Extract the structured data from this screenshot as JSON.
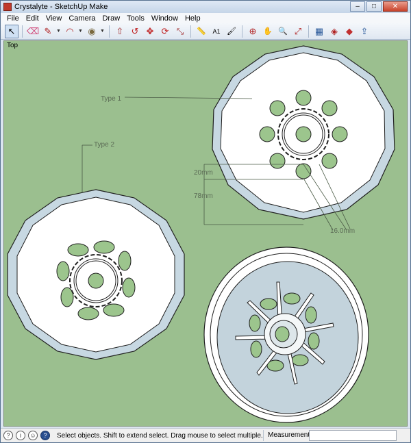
{
  "window": {
    "title": "Crystalyte - SketchUp Make",
    "controls": {
      "minimize": "–",
      "maximize": "□",
      "close": "✕"
    }
  },
  "menubar": {
    "items": [
      "File",
      "Edit",
      "View",
      "Camera",
      "Draw",
      "Tools",
      "Window",
      "Help"
    ]
  },
  "toolbar": {
    "tools": [
      {
        "name": "select-tool",
        "glyph": "↖"
      },
      {
        "name": "eraser-tool",
        "glyph": "⌫"
      },
      {
        "name": "pencil-tool",
        "glyph": "✎"
      },
      {
        "name": "arc-tool",
        "glyph": "◠"
      },
      {
        "name": "paint-bucket-tool",
        "glyph": "◉"
      },
      {
        "name": "push-pull-tool",
        "glyph": "⇧"
      },
      {
        "name": "follow-me-tool",
        "glyph": "↺"
      },
      {
        "name": "move-tool",
        "glyph": "✥"
      },
      {
        "name": "rotate-tool",
        "glyph": "⟳"
      },
      {
        "name": "scale-tool",
        "glyph": "⤡"
      },
      {
        "name": "tape-measure-tool",
        "glyph": "📏"
      },
      {
        "name": "text-tool",
        "glyph": "A1"
      },
      {
        "name": "paint-tool",
        "glyph": "🖌"
      },
      {
        "name": "orbit-tool",
        "glyph": "⊕"
      },
      {
        "name": "pan-tool",
        "glyph": "✋"
      },
      {
        "name": "zoom-tool",
        "glyph": "🔍"
      },
      {
        "name": "zoom-extents-tool",
        "glyph": "⤢"
      },
      {
        "name": "3d-warehouse-tool",
        "glyph": "▦"
      },
      {
        "name": "components-tool",
        "glyph": "◈"
      },
      {
        "name": "extension-tool",
        "glyph": "◆"
      },
      {
        "name": "share-model-tool",
        "glyph": "⇪"
      }
    ]
  },
  "viewport": {
    "view_label": "Top",
    "labels": {
      "type1": "Type 1",
      "type2": "Type 2",
      "dim_20": "20mm",
      "dim_78": "78mm",
      "dim_16": "16.0mm"
    },
    "colors": {
      "background": "#9bbf8f",
      "rim": "#c7d8e2",
      "disc": "#ffffff",
      "hole": "#9cc58d",
      "outline": "#1f1f1f"
    }
  },
  "statusbar": {
    "message": "Select objects. Shift to extend select. Drag mouse to select multiple.",
    "measurements_label": "Measurements",
    "measurements_value": ""
  }
}
